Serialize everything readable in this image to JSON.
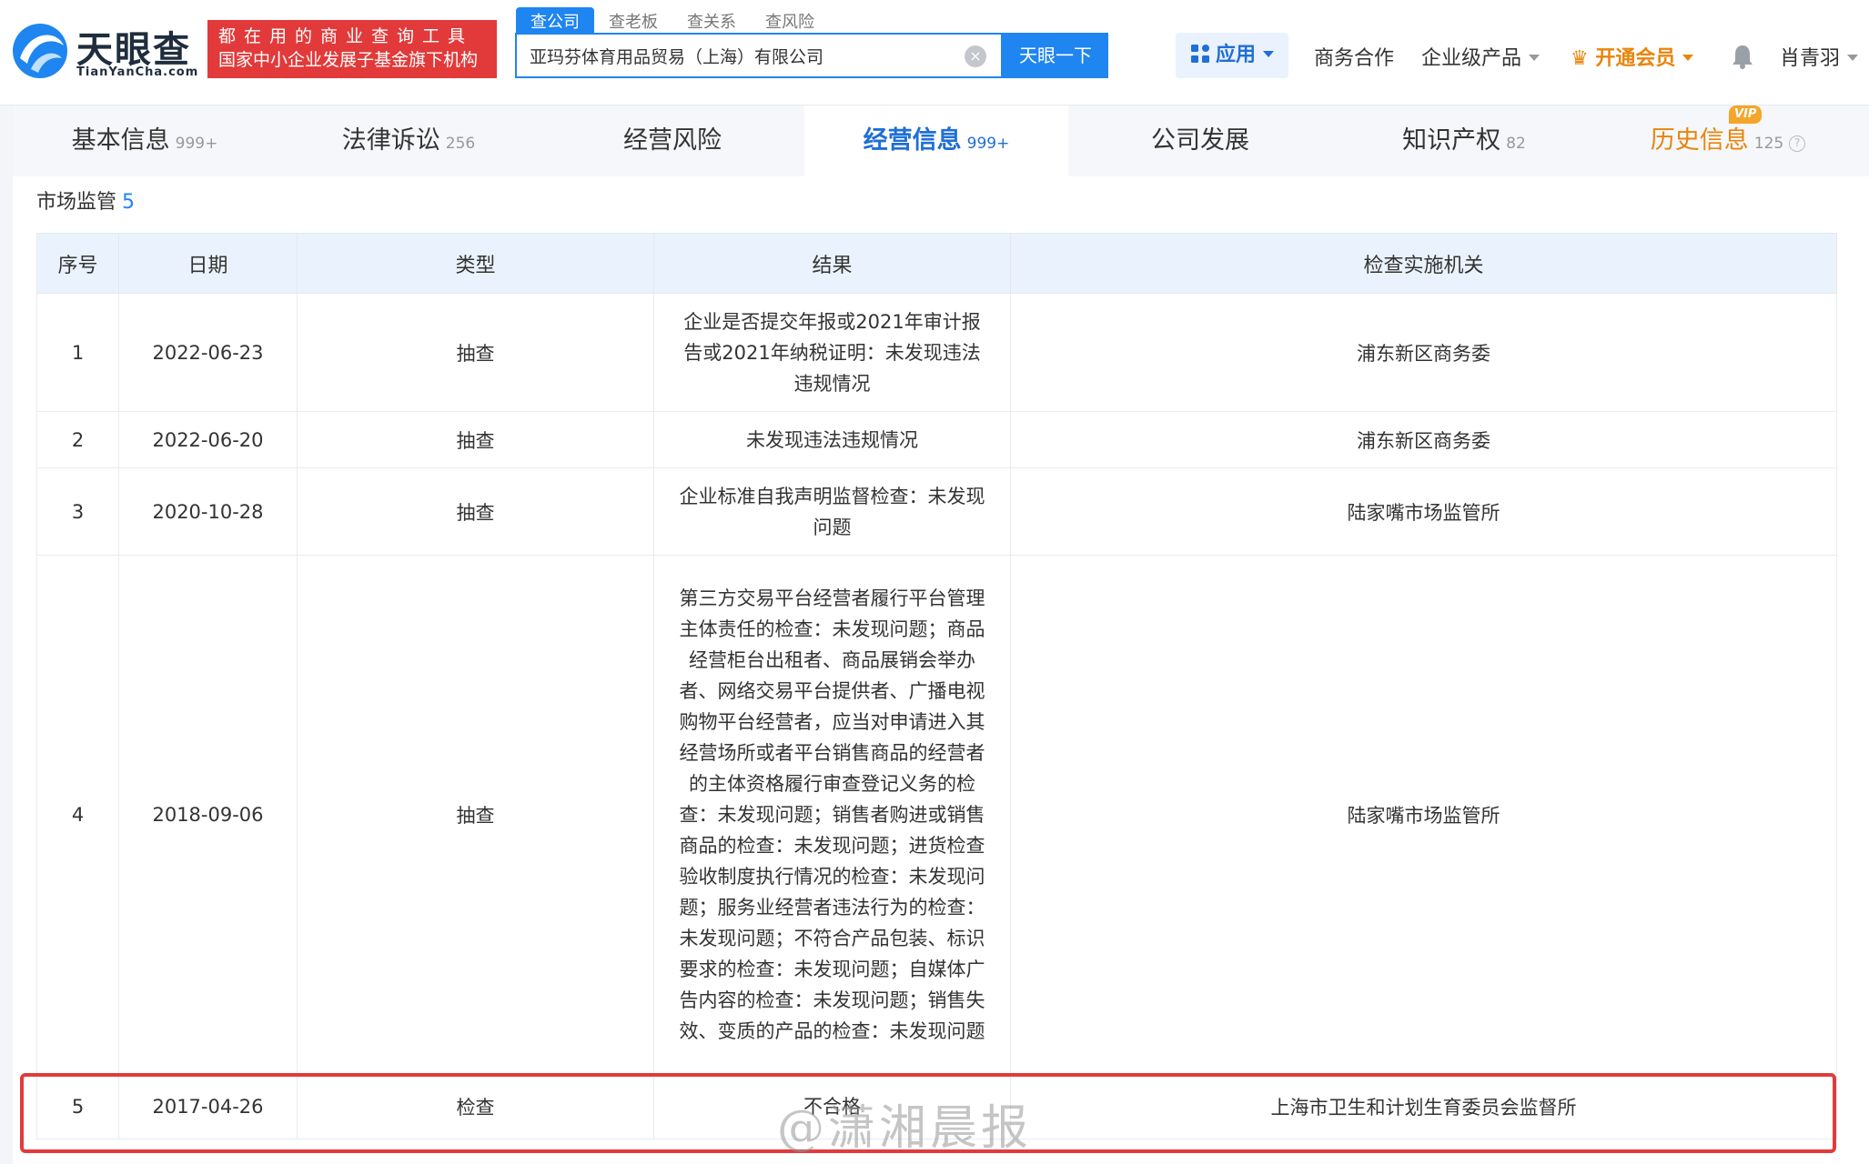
{
  "header": {
    "logo_text": "天眼查",
    "logo_sub": "TianYanCha.com",
    "slogan_line1": "都在用的商业查询工具",
    "slogan_line2": "国家中小企业发展子基金旗下机构",
    "search_tabs": [
      "查公司",
      "查老板",
      "查关系",
      "查风险"
    ],
    "search_value": "亚玛芬体育用品贸易（上海）有限公司",
    "search_button": "天眼一下",
    "apps_label": "应用",
    "nav_business": "商务合作",
    "nav_enterprise": "企业级产品",
    "nav_vip": "开通会员",
    "user_name": "肖青羽"
  },
  "tabs": [
    {
      "label": "基本信息",
      "count": "999+"
    },
    {
      "label": "法律诉讼",
      "count": "256"
    },
    {
      "label": "经营风险",
      "count": ""
    },
    {
      "label": "经营信息",
      "count": "999+"
    },
    {
      "label": "公司发展",
      "count": ""
    },
    {
      "label": "知识产权",
      "count": "82"
    },
    {
      "label": "历史信息",
      "count": "125"
    }
  ],
  "vip_badge": "VIP",
  "section": {
    "title": "市场监管",
    "count": "5"
  },
  "table": {
    "headers": [
      "序号",
      "日期",
      "类型",
      "结果",
      "检查实施机关"
    ],
    "rows": [
      {
        "no": "1",
        "date": "2022-06-23",
        "type": "抽查",
        "result": "企业是否提交年报或2021年审计报告或2021年纳税证明：未发现违法违规情况",
        "agency": "浦东新区商务委"
      },
      {
        "no": "2",
        "date": "2022-06-20",
        "type": "抽查",
        "result": "未发现违法违规情况",
        "agency": "浦东新区商务委"
      },
      {
        "no": "3",
        "date": "2020-10-28",
        "type": "抽查",
        "result": "企业标准自我声明监督检查：未发现问题",
        "agency": "陆家嘴市场监管所"
      },
      {
        "no": "4",
        "date": "2018-09-06",
        "type": "抽查",
        "result": "第三方交易平台经营者履行平台管理主体责任的检查：未发现问题；商品经营柜台出租者、商品展销会举办者、网络交易平台提供者、广播电视购物平台经营者，应当对申请进入其经营场所或者平台销售商品的经营者的主体资格履行审查登记义务的检查：未发现问题；销售者购进或销售商品的检查：未发现问题；进货检查验收制度执行情况的检查：未发现问题；服务业经营者违法行为的检查：未发现问题；不符合产品包装、标识要求的检查：未发现问题；自媒体广告内容的检查：未发现问题；销售失效、变质的产品的检查：未发现问题",
        "agency": "陆家嘴市场监管所"
      },
      {
        "no": "5",
        "date": "2017-04-26",
        "type": "检查",
        "result": "不合格",
        "agency": "上海市卫生和计划生育委员会监督所"
      }
    ]
  },
  "watermark": "@潇湘晨报",
  "colors": {
    "brand_blue": "#1f85f0",
    "alert_red": "#e23a3a",
    "vip_orange": "#e8850c"
  }
}
